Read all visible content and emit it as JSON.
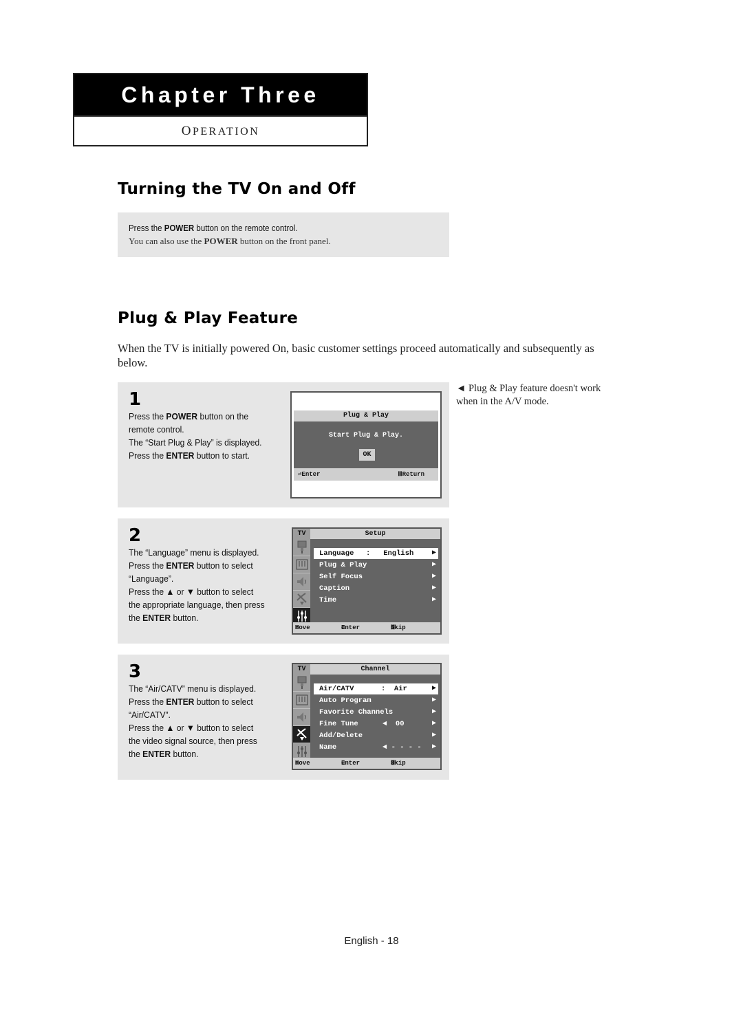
{
  "chapter": {
    "title": "Chapter Three",
    "subtitle_first": "O",
    "subtitle_rest": "PERATION"
  },
  "section1": {
    "heading": "Turning the TV On and Off",
    "note": {
      "line1_pre": "Press the ",
      "line1_bold": "POWER",
      "line1_post": " button on the remote control.",
      "line2_pre": "You can also use the ",
      "line2_bold": "POWER",
      "line2_post": " button on the front panel."
    }
  },
  "section2": {
    "heading": "Plug & Play Feature",
    "intro": "When the TV is initially powered On, basic customer settings proceed automatically and subsequently as below.",
    "side_note": "◄ Plug & Play feature doesn't work when in the A/V mode.",
    "steps": [
      {
        "number": "1",
        "lines": [
          {
            "pre": "Press the ",
            "bold": "POWER",
            "post": " button on the"
          },
          {
            "pre": "remote control.",
            "bold": "",
            "post": ""
          },
          {
            "pre": "The “Start Plug & Play” is displayed.",
            "bold": "",
            "post": ""
          },
          {
            "pre": "Press the ",
            "bold": "ENTER",
            "post": " button to start."
          }
        ],
        "screen": {
          "title": "Plug & Play",
          "message": "Start Plug & Play.",
          "ok_label": "OK",
          "footer_left": "Enter",
          "footer_right": "Return"
        }
      },
      {
        "number": "2",
        "lines": [
          {
            "pre": "The “Language” menu is displayed.",
            "bold": "",
            "post": ""
          },
          {
            "pre": "Press the ",
            "bold": "ENTER",
            "post": " button to select"
          },
          {
            "pre": "“Language”.",
            "bold": "",
            "post": ""
          },
          {
            "pre": "Press the ▲ or ▼ button to select",
            "bold": "",
            "post": ""
          },
          {
            "pre": "the appropriate language, then press",
            "bold": "",
            "post": ""
          },
          {
            "pre": "the ",
            "bold": "ENTER",
            "post": " button."
          }
        ],
        "screen": {
          "tv_label": "TV",
          "title": "Setup",
          "items": [
            {
              "label": "Language",
              "value": ":   English",
              "selected": true
            },
            {
              "label": "Plug & Play",
              "value": "",
              "selected": false
            },
            {
              "label": "Self Focus",
              "value": "",
              "selected": false
            },
            {
              "label": "Caption",
              "value": "",
              "selected": false
            },
            {
              "label": "Time",
              "value": "",
              "selected": false
            }
          ],
          "footer": {
            "move": "Move",
            "enter": "Enter",
            "skip": "Skip"
          }
        }
      },
      {
        "number": "3",
        "lines": [
          {
            "pre": "The “Air/CATV” menu is displayed.",
            "bold": "",
            "post": ""
          },
          {
            "pre": "Press the ",
            "bold": "ENTER",
            "post": " button to select"
          },
          {
            "pre": "“Air/CATV”.",
            "bold": "",
            "post": ""
          },
          {
            "pre": "Press the ▲ or ▼ button to select",
            "bold": "",
            "post": ""
          },
          {
            "pre": "the video signal source, then press",
            "bold": "",
            "post": ""
          },
          {
            "pre": "the ",
            "bold": "ENTER",
            "post": " button."
          }
        ],
        "screen": {
          "tv_label": "TV",
          "title": "Channel",
          "items": [
            {
              "label": "Air/CATV",
              "value": ":  Air",
              "selected": true
            },
            {
              "label": "Auto Program",
              "value": "",
              "selected": false
            },
            {
              "label": "Favorite Channels",
              "value": "",
              "selected": false
            },
            {
              "label": "Fine Tune",
              "value": "◄  00",
              "selected": false
            },
            {
              "label": "Add/Delete",
              "value": "",
              "selected": false
            },
            {
              "label": "Name",
              "value": "◄ - - - -",
              "selected": false
            }
          ],
          "footer": {
            "move": "Move",
            "enter": "Enter",
            "skip": "Skip"
          }
        }
      }
    ]
  },
  "footer": {
    "page_label": "English - 18"
  }
}
